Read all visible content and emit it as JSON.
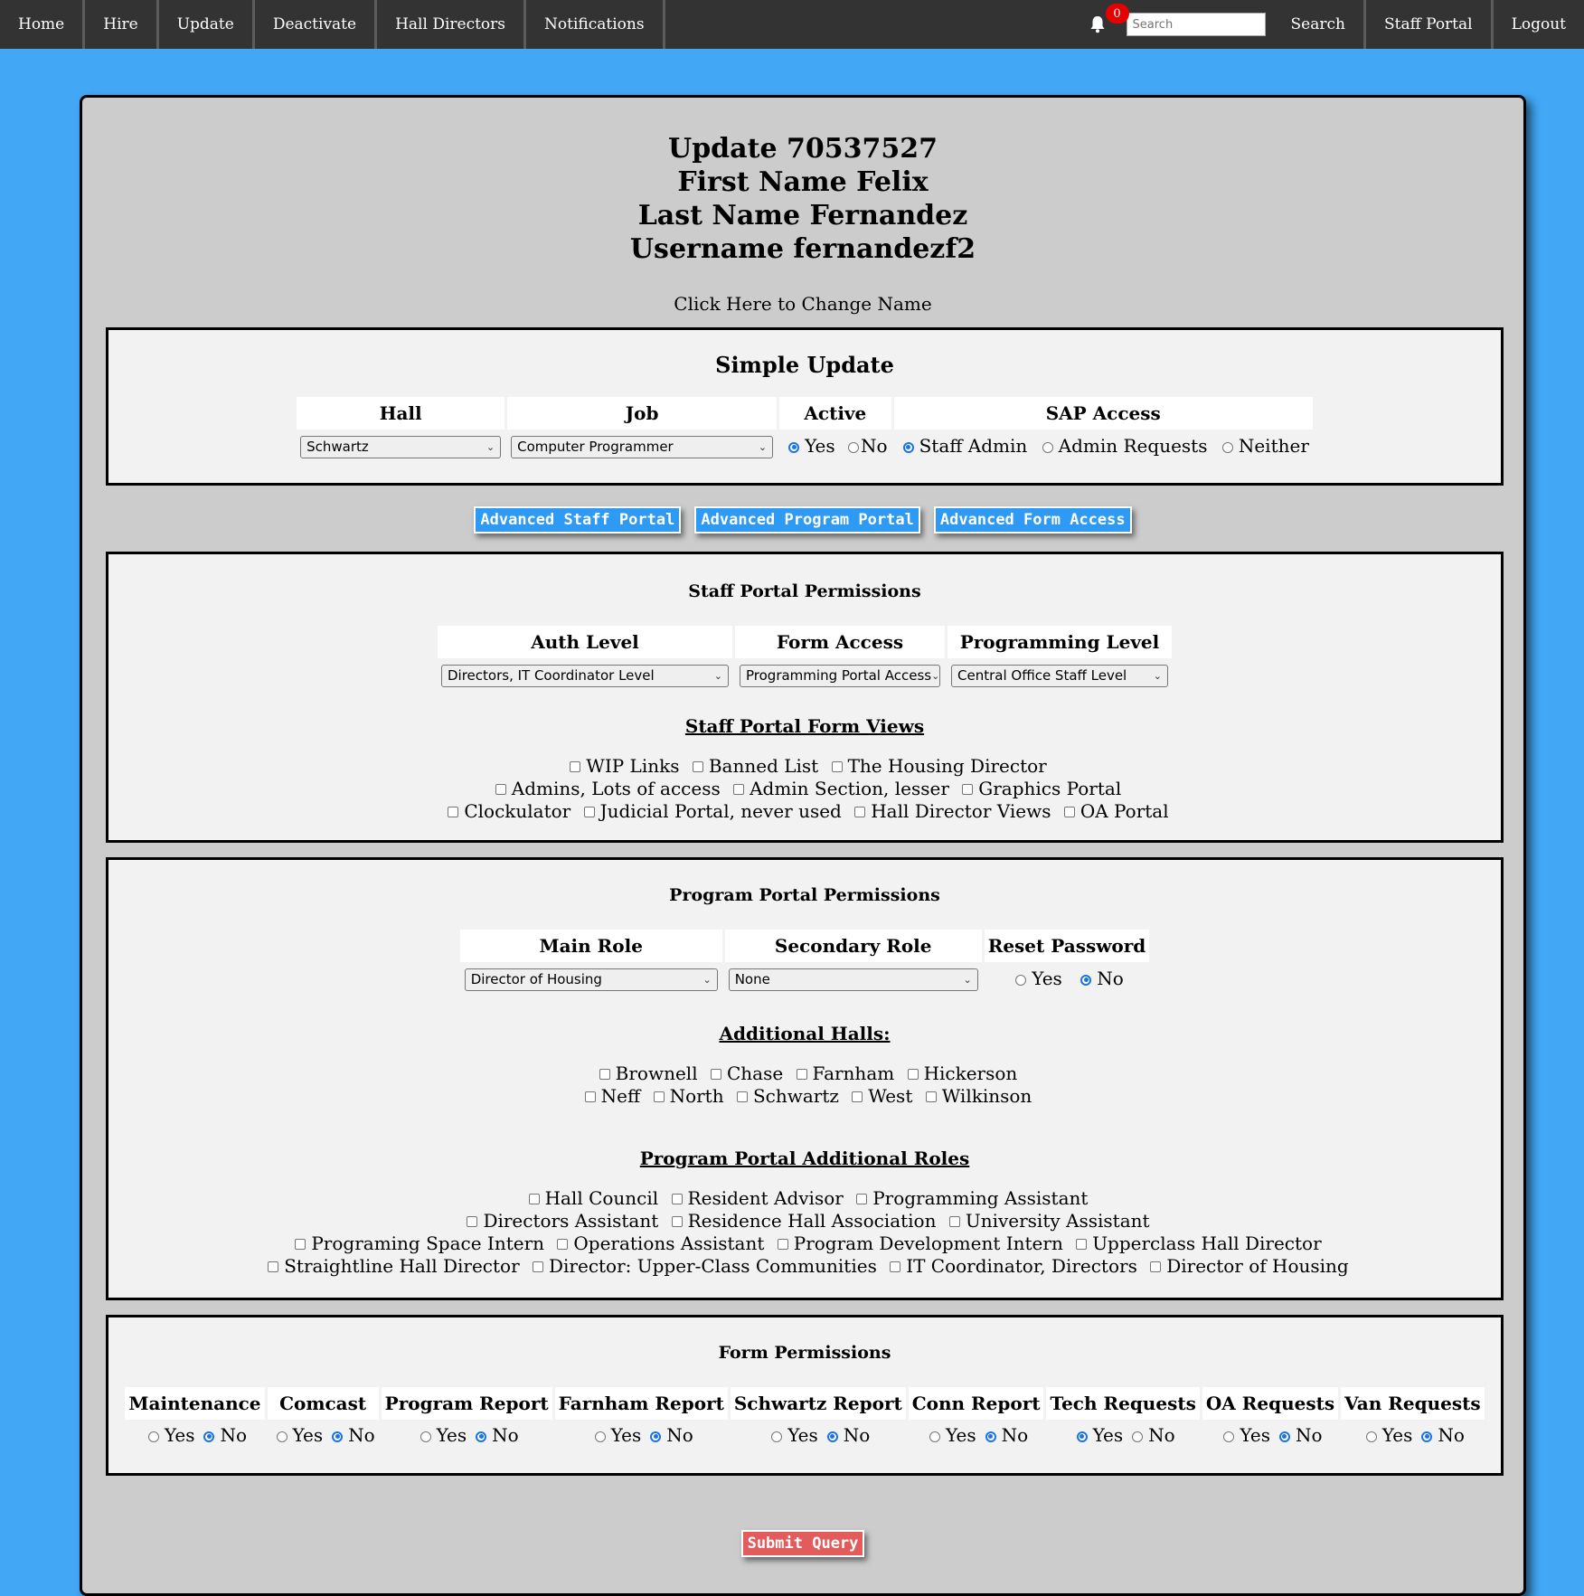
{
  "nav": {
    "left": [
      "Home",
      "Hire",
      "Update",
      "Deactivate",
      "Hall Directors",
      "Notifications"
    ],
    "badge_count": "0",
    "search_placeholder": "Search",
    "search_label": "Search",
    "staff_portal": "Staff Portal",
    "logout": "Logout"
  },
  "header": {
    "update_line": "Update 70537527",
    "first_name_line": "First Name Felix",
    "last_name_line": "Last Name Fernandez",
    "username_line": "Username fernandezf2",
    "change_name": "Click Here to Change Name"
  },
  "simple_update": {
    "title": "Simple Update",
    "headers": [
      "Hall",
      "Job",
      "Active",
      "SAP Access"
    ],
    "hall_value": "Schwartz",
    "job_value": "Computer Programmer",
    "active_options": [
      "Yes",
      "No"
    ],
    "active_selected": "Yes",
    "sap_options": [
      "Staff Admin",
      "Admin Requests",
      "Neither"
    ],
    "sap_selected": "Staff Admin"
  },
  "advanced_buttons": [
    "Advanced Staff Portal",
    "Advanced Program Portal",
    "Advanced Form Access"
  ],
  "staff_portal": {
    "title": "Staff Portal Permissions",
    "headers": [
      "Auth Level",
      "Form Access",
      "Programming Level"
    ],
    "auth_level_value": "Directors, IT Coordinator Level",
    "form_access_value": "Programming Portal Access",
    "programming_level_value": "Central Office Staff Level",
    "form_views_title": "Staff Portal Form Views",
    "form_views_rows": [
      [
        "WIP Links",
        "Banned List",
        "The Housing Director"
      ],
      [
        "Admins, Lots of access",
        "Admin Section, lesser",
        "Graphics Portal"
      ],
      [
        "Clockulator",
        "Judicial Portal, never used",
        "Hall Director Views",
        "OA Portal"
      ]
    ]
  },
  "program_portal": {
    "title": "Program Portal Permissions",
    "headers": [
      "Main Role",
      "Secondary Role",
      "Reset Password"
    ],
    "main_role_value": "Director of Housing",
    "secondary_role_value": "None",
    "reset_options": [
      "Yes",
      "No"
    ],
    "reset_selected": "No",
    "halls_title": "Additional Halls:",
    "halls_rows": [
      [
        "Brownell",
        "Chase",
        "Farnham",
        "Hickerson"
      ],
      [
        "Neff",
        "North",
        "Schwartz",
        "West",
        "Wilkinson"
      ]
    ],
    "roles_title": "Program Portal Additional Roles",
    "roles_rows": [
      [
        "Hall Council",
        "Resident Advisor",
        "Programming Assistant"
      ],
      [
        "Directors Assistant",
        "Residence Hall Association",
        "University Assistant"
      ],
      [
        "Programing Space Intern",
        "Operations Assistant",
        "Program Development Intern",
        "Upperclass Hall Director"
      ],
      [
        "Straightline Hall Director",
        "Director: Upper-Class Communities",
        "IT Coordinator, Directors",
        "Director of Housing"
      ]
    ]
  },
  "form_permissions": {
    "title": "Form Permissions",
    "columns": [
      {
        "label": "Maintenance",
        "selected": "No"
      },
      {
        "label": "Comcast",
        "selected": "No"
      },
      {
        "label": "Program Report",
        "selected": "No"
      },
      {
        "label": "Farnham Report",
        "selected": "No"
      },
      {
        "label": "Schwartz Report",
        "selected": "No"
      },
      {
        "label": "Conn Report",
        "selected": "No"
      },
      {
        "label": "Tech Requests",
        "selected": "Yes"
      },
      {
        "label": "OA Requests",
        "selected": "No"
      },
      {
        "label": "Van Requests",
        "selected": "No"
      }
    ],
    "yes_label": "Yes",
    "no_label": "No"
  },
  "submit_label": "Submit Query",
  "colors": {
    "background": "#42a7f5",
    "nav": "#333333",
    "panel": "#cccccc",
    "box": "#f2f2f2",
    "button_blue": "#2e9af3",
    "button_red": "#e25c5c",
    "badge": "#e60000"
  }
}
